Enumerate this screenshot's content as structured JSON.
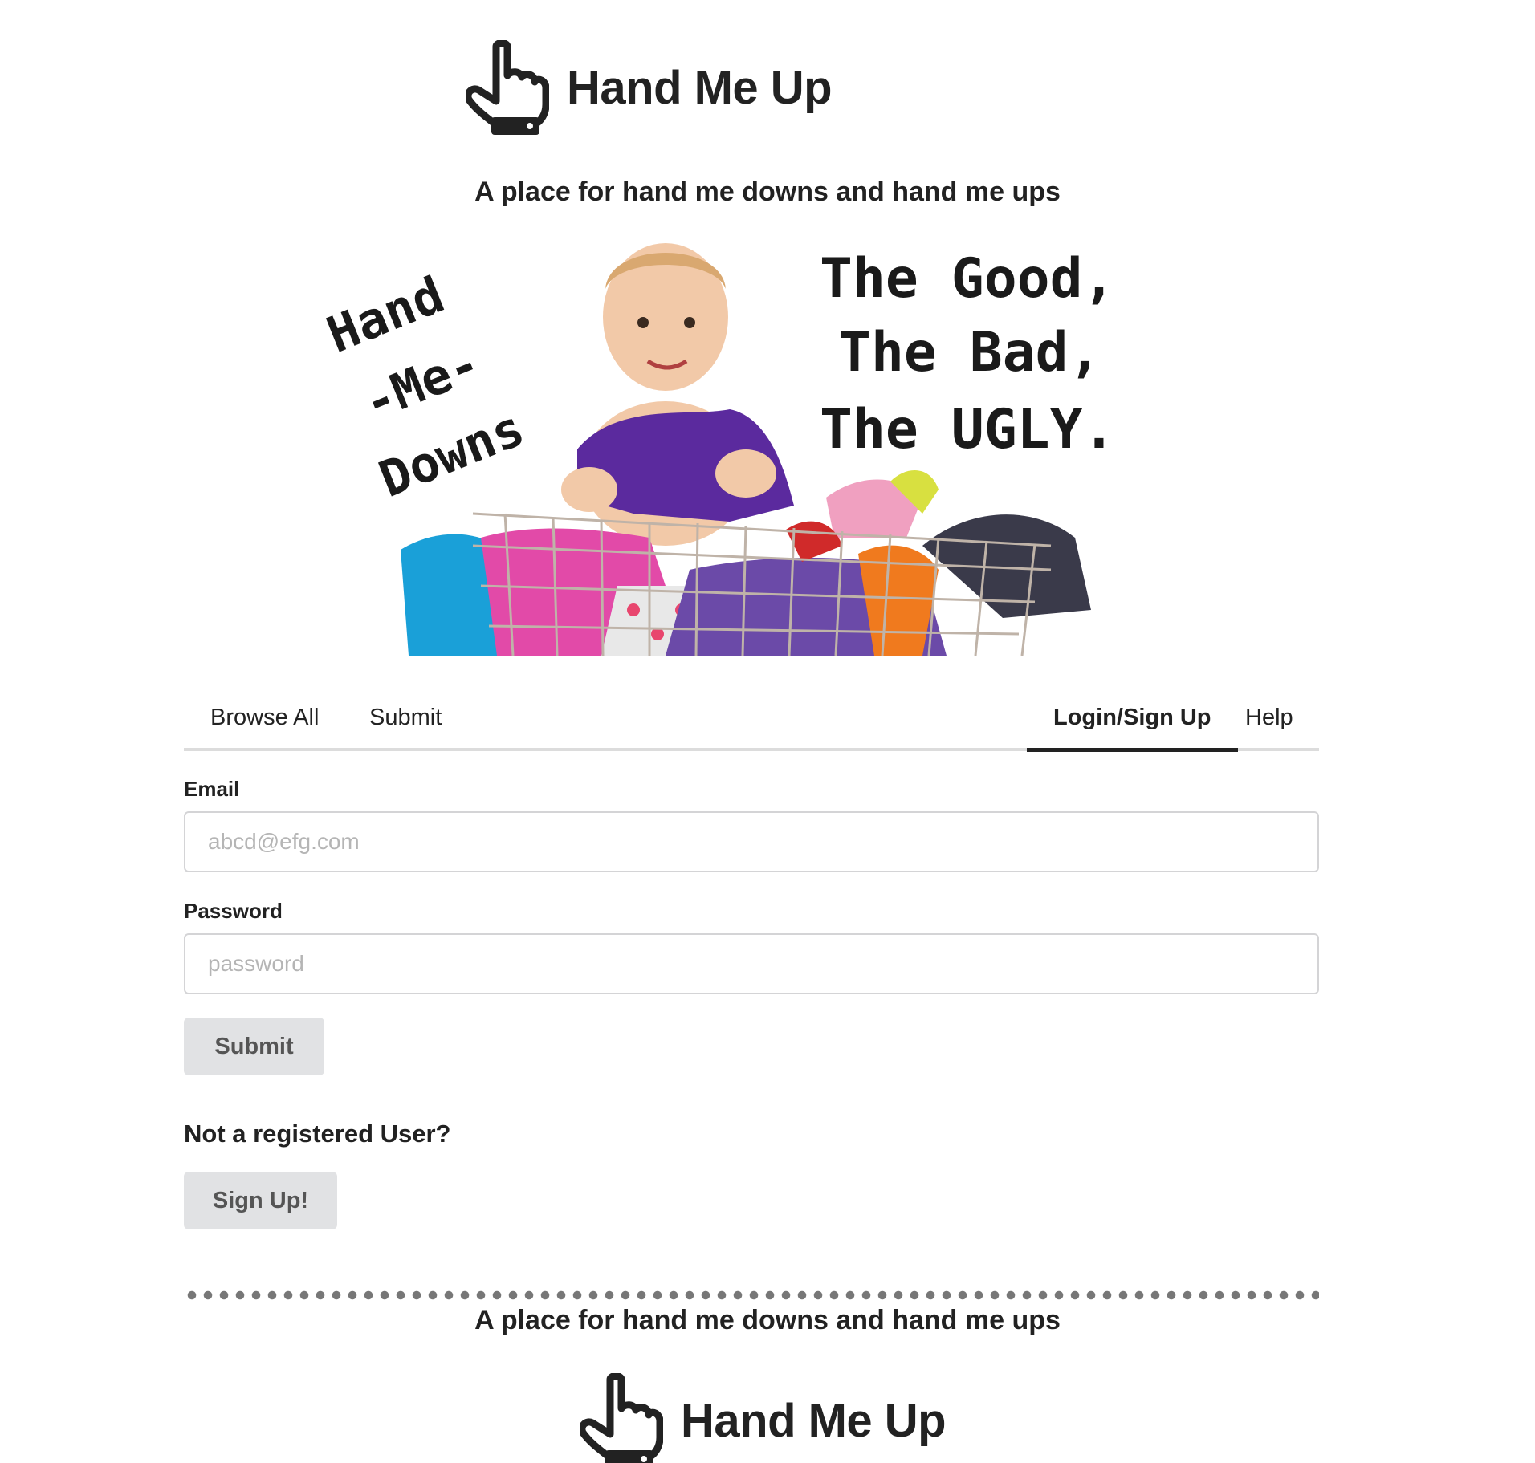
{
  "header": {
    "brand_name": "Hand Me Up",
    "logo_icon": "pointing-hand-icon",
    "tagline": "A place for hand me downs and hand me ups"
  },
  "hero": {
    "left_text": [
      "Hand",
      "-Me-",
      "Downs"
    ],
    "right_text": [
      "The Good,",
      "The Bad,",
      "The UGLY."
    ]
  },
  "nav": {
    "tabs": [
      {
        "label": "Browse All",
        "active": false
      },
      {
        "label": "Submit",
        "active": false
      },
      {
        "label": "Login/Sign Up",
        "active": true
      },
      {
        "label": "Help",
        "active": false
      }
    ]
  },
  "login_form": {
    "email_label": "Email",
    "email_placeholder": "abcd@efg.com",
    "password_label": "Password",
    "password_placeholder": "password",
    "submit_label": "Submit",
    "not_registered_text": "Not a registered User?",
    "signup_label": "Sign Up!"
  },
  "footer": {
    "tagline": "A place for hand me downs and hand me ups",
    "brand_name": "Hand Me Up"
  },
  "colors": {
    "text": "#222222",
    "button_bg": "#e1e2e4",
    "input_border": "#d4d4d6",
    "tab_rule": "#dcdcdc"
  }
}
